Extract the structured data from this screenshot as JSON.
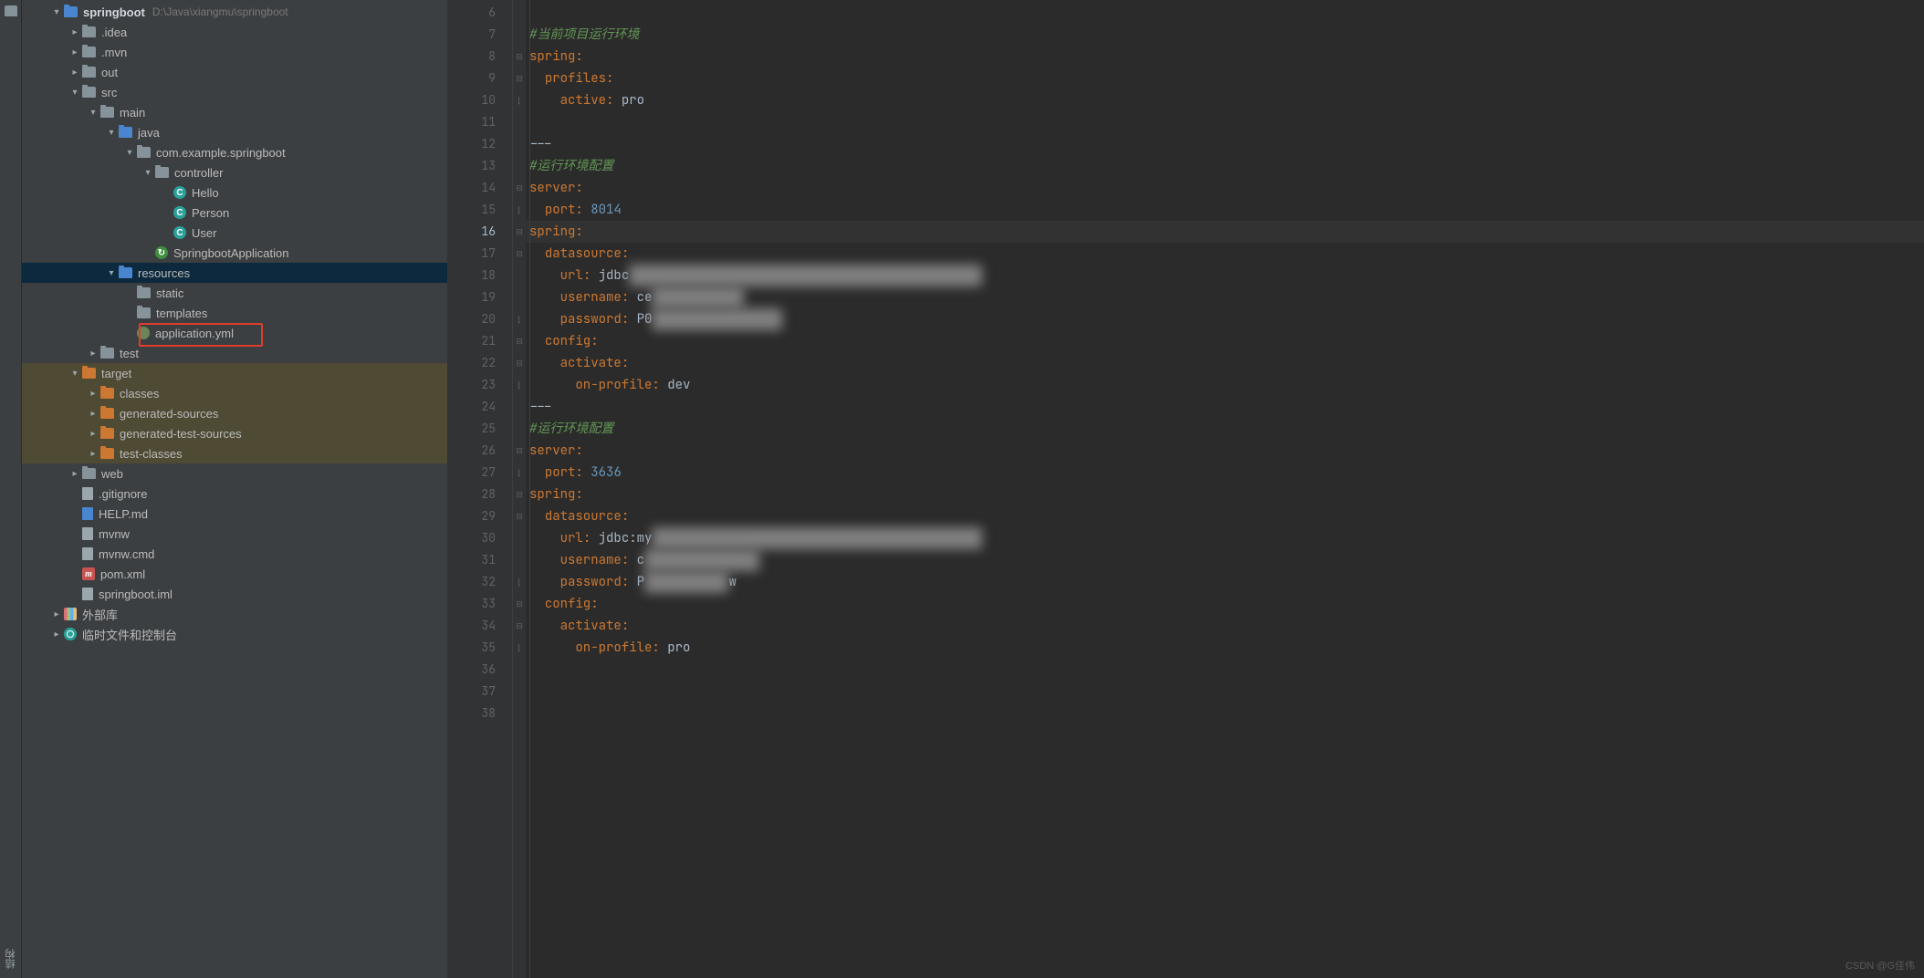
{
  "project": {
    "root_name": "springboot",
    "root_path": "D:\\Java\\xiangmu\\springboot",
    "tree": {
      "idea": ".idea",
      "mvn": ".mvn",
      "out": "out",
      "src": "src",
      "main": "main",
      "java": "java",
      "pkg": "com.example.springboot",
      "controller": "controller",
      "hello": "Hello",
      "person": "Person",
      "user": "User",
      "app_class": "SpringbootApplication",
      "resources": "resources",
      "static": "static",
      "templates": "templates",
      "app_yml": "application.yml",
      "test": "test",
      "target": "target",
      "classes": "classes",
      "gen_sources": "generated-sources",
      "gen_test_sources": "generated-test-sources",
      "test_classes": "test-classes",
      "web": "web",
      "gitignore": ".gitignore",
      "help": "HELP.md",
      "mvnw": "mvnw",
      "mvnw_cmd": "mvnw.cmd",
      "pom": "pom.xml",
      "iml": "springboot.iml",
      "ext_lib": "外部库",
      "scratches": "临时文件和控制台"
    },
    "bottom_tab": "结构"
  },
  "editor": {
    "lines": [
      {
        "n": 6,
        "fold": "",
        "tokens": []
      },
      {
        "n": 7,
        "fold": "",
        "tokens": [
          {
            "t": "#当前项目运行环境",
            "c": "c-comment"
          }
        ]
      },
      {
        "n": 8,
        "fold": "⊟",
        "tokens": [
          {
            "t": "spring",
            "c": "c-key"
          },
          {
            "t": ":",
            "c": "c-punc"
          }
        ]
      },
      {
        "n": 9,
        "fold": "⊟",
        "tokens": [
          {
            "t": "  ",
            "c": ""
          },
          {
            "t": "profiles",
            "c": "c-key"
          },
          {
            "t": ":",
            "c": "c-punc"
          }
        ]
      },
      {
        "n": 10,
        "fold": "⌊",
        "tokens": [
          {
            "t": "    ",
            "c": ""
          },
          {
            "t": "active",
            "c": "c-key"
          },
          {
            "t": ": ",
            "c": "c-punc"
          },
          {
            "t": "pro",
            "c": "c-str"
          }
        ]
      },
      {
        "n": 11,
        "fold": "",
        "tokens": []
      },
      {
        "n": 12,
        "fold": "",
        "tokens": [
          {
            "t": "---",
            "c": "c-str"
          }
        ]
      },
      {
        "n": 13,
        "fold": "",
        "tokens": [
          {
            "t": "#运行环境配置",
            "c": "c-comment"
          }
        ]
      },
      {
        "n": 14,
        "fold": "⊟",
        "tokens": [
          {
            "t": "server",
            "c": "c-key"
          },
          {
            "t": ":",
            "c": "c-punc"
          }
        ]
      },
      {
        "n": 15,
        "fold": "⌊",
        "tokens": [
          {
            "t": "  ",
            "c": ""
          },
          {
            "t": "port",
            "c": "c-key"
          },
          {
            "t": ": ",
            "c": "c-punc"
          },
          {
            "t": "8014",
            "c": "c-val"
          }
        ]
      },
      {
        "n": 16,
        "fold": "⊟",
        "current": true,
        "tokens": [
          {
            "t": "spring",
            "c": "c-key"
          },
          {
            "t": ":",
            "c": "c-punc"
          }
        ]
      },
      {
        "n": 17,
        "fold": "⊟",
        "tokens": [
          {
            "t": "  ",
            "c": ""
          },
          {
            "t": "datasource",
            "c": "c-key"
          },
          {
            "t": ":",
            "c": "c-punc"
          }
        ]
      },
      {
        "n": 18,
        "fold": "",
        "tokens": [
          {
            "t": "    ",
            "c": ""
          },
          {
            "t": "url",
            "c": "c-key"
          },
          {
            "t": ": ",
            "c": "c-punc"
          },
          {
            "t": "jdbc",
            "c": "c-str"
          },
          {
            "t": "                                              ",
            "c": "blur"
          }
        ]
      },
      {
        "n": 19,
        "fold": "",
        "tokens": [
          {
            "t": "    ",
            "c": ""
          },
          {
            "t": "username",
            "c": "c-key"
          },
          {
            "t": ": ",
            "c": "c-punc"
          },
          {
            "t": "ce",
            "c": "c-str"
          },
          {
            "t": "            ",
            "c": "blur"
          }
        ]
      },
      {
        "n": 20,
        "fold": "⌊",
        "tokens": [
          {
            "t": "    ",
            "c": ""
          },
          {
            "t": "password",
            "c": "c-key"
          },
          {
            "t": ": ",
            "c": "c-punc"
          },
          {
            "t": "P0",
            "c": "c-str"
          },
          {
            "t": "                 ",
            "c": "blur"
          }
        ]
      },
      {
        "n": 21,
        "fold": "⊟",
        "tokens": [
          {
            "t": "  ",
            "c": ""
          },
          {
            "t": "config",
            "c": "c-key"
          },
          {
            "t": ":",
            "c": "c-punc"
          }
        ]
      },
      {
        "n": 22,
        "fold": "⊟",
        "tokens": [
          {
            "t": "    ",
            "c": ""
          },
          {
            "t": "activate",
            "c": "c-key"
          },
          {
            "t": ":",
            "c": "c-punc"
          }
        ]
      },
      {
        "n": 23,
        "fold": "⌊",
        "tokens": [
          {
            "t": "      ",
            "c": ""
          },
          {
            "t": "on-profile",
            "c": "c-key"
          },
          {
            "t": ": ",
            "c": "c-punc"
          },
          {
            "t": "dev",
            "c": "c-str"
          }
        ]
      },
      {
        "n": 24,
        "fold": "",
        "tokens": [
          {
            "t": "---",
            "c": "c-str"
          }
        ]
      },
      {
        "n": 25,
        "fold": "",
        "tokens": [
          {
            "t": "#运行环境配置",
            "c": "c-comment"
          }
        ]
      },
      {
        "n": 26,
        "fold": "⊟",
        "tokens": [
          {
            "t": "server",
            "c": "c-key"
          },
          {
            "t": ":",
            "c": "c-punc"
          }
        ]
      },
      {
        "n": 27,
        "fold": "⌊",
        "tokens": [
          {
            "t": "  ",
            "c": ""
          },
          {
            "t": "port",
            "c": "c-key"
          },
          {
            "t": ": ",
            "c": "c-punc"
          },
          {
            "t": "3636",
            "c": "c-val"
          }
        ]
      },
      {
        "n": 28,
        "fold": "⊟",
        "tokens": [
          {
            "t": "spring",
            "c": "c-key"
          },
          {
            "t": ":",
            "c": "c-punc"
          }
        ]
      },
      {
        "n": 29,
        "fold": "⊟",
        "tokens": [
          {
            "t": "  ",
            "c": ""
          },
          {
            "t": "datasource",
            "c": "c-key"
          },
          {
            "t": ":",
            "c": "c-punc"
          }
        ]
      },
      {
        "n": 30,
        "fold": "",
        "tokens": [
          {
            "t": "    ",
            "c": ""
          },
          {
            "t": "url",
            "c": "c-key"
          },
          {
            "t": ": ",
            "c": "c-punc"
          },
          {
            "t": "jdbc:my",
            "c": "c-str"
          },
          {
            "t": "                                           ",
            "c": "blur"
          }
        ]
      },
      {
        "n": 31,
        "fold": "",
        "tokens": [
          {
            "t": "    ",
            "c": ""
          },
          {
            "t": "username",
            "c": "c-key"
          },
          {
            "t": ": ",
            "c": "c-punc"
          },
          {
            "t": "c",
            "c": "c-str"
          },
          {
            "t": "               ",
            "c": "blur"
          }
        ]
      },
      {
        "n": 32,
        "fold": "⌊",
        "tokens": [
          {
            "t": "    ",
            "c": ""
          },
          {
            "t": "password",
            "c": "c-key"
          },
          {
            "t": ": ",
            "c": "c-punc"
          },
          {
            "t": "P",
            "c": "c-str"
          },
          {
            "t": "           ",
            "c": "blur"
          },
          {
            "t": "w",
            "c": "c-str"
          }
        ]
      },
      {
        "n": 33,
        "fold": "⊟",
        "tokens": [
          {
            "t": "  ",
            "c": ""
          },
          {
            "t": "config",
            "c": "c-key"
          },
          {
            "t": ":",
            "c": "c-punc"
          }
        ]
      },
      {
        "n": 34,
        "fold": "⊟",
        "tokens": [
          {
            "t": "    ",
            "c": ""
          },
          {
            "t": "activate",
            "c": "c-key"
          },
          {
            "t": ":",
            "c": "c-punc"
          }
        ]
      },
      {
        "n": 35,
        "fold": "⌊",
        "tokens": [
          {
            "t": "      ",
            "c": ""
          },
          {
            "t": "on-profile",
            "c": "c-key"
          },
          {
            "t": ": ",
            "c": "c-punc"
          },
          {
            "t": "pro",
            "c": "c-str"
          }
        ]
      },
      {
        "n": 36,
        "fold": "",
        "tokens": []
      },
      {
        "n": 37,
        "fold": "",
        "tokens": []
      },
      {
        "n": 38,
        "fold": "",
        "tokens": []
      }
    ]
  },
  "watermark": "CSDN @G佳伟"
}
